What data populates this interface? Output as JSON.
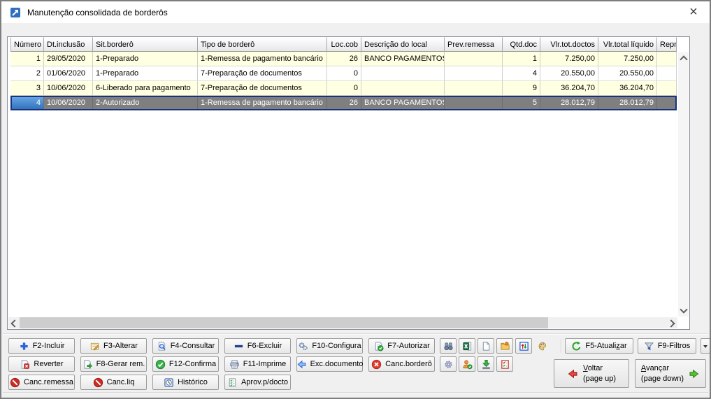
{
  "window": {
    "title": "Manutenção consolidada de borderôs",
    "close_glyph": "×"
  },
  "table": {
    "columns": [
      {
        "key": "numero",
        "label": "Número",
        "width": 48,
        "align": "right"
      },
      {
        "key": "dt-inclusao",
        "label": "Dt.inclusão",
        "width": 70,
        "align": "left"
      },
      {
        "key": "sit-bordero",
        "label": "Sit.borderô",
        "width": 150,
        "align": "left"
      },
      {
        "key": "tipo-bordero",
        "label": "Tipo de borderô",
        "width": 185,
        "align": "left"
      },
      {
        "key": "loc-cob",
        "label": "Loc.cob",
        "width": 49,
        "align": "right"
      },
      {
        "key": "descricao-local",
        "label": "Descrição do local",
        "width": 119,
        "align": "left"
      },
      {
        "key": "prev-remessa",
        "label": "Prev.remessa",
        "width": 83,
        "align": "left"
      },
      {
        "key": "qtd-doc",
        "label": "Qtd.doc",
        "width": 54,
        "align": "right"
      },
      {
        "key": "vlr-tot-doctos",
        "label": "Vlr.tot.doctos",
        "width": 83,
        "align": "right"
      },
      {
        "key": "vlr-total-liquido",
        "label": "Vlr.total líquido",
        "width": 84,
        "align": "right"
      },
      {
        "key": "repre",
        "label": "Repre",
        "width": 28,
        "align": "left"
      }
    ],
    "rows": [
      {
        "selected": false,
        "cells": [
          "1",
          "29/05/2020",
          "1-Preparado",
          "1-Remessa de pagamento bancário",
          "26",
          "BANCO PAGAMENTOS",
          "",
          "1",
          "7.250,00",
          "7.250,00",
          ""
        ]
      },
      {
        "selected": false,
        "cells": [
          "2",
          "01/06/2020",
          "1-Preparado",
          "7-Preparação de documentos",
          "0",
          "",
          "",
          "4",
          "20.550,00",
          "20.550,00",
          ""
        ]
      },
      {
        "selected": false,
        "cells": [
          "3",
          "10/06/2020",
          "6-Liberado para pagamento",
          "7-Preparação de documentos",
          "0",
          "",
          "",
          "9",
          "36.204,70",
          "36.204,70",
          ""
        ]
      },
      {
        "selected": true,
        "cells": [
          "4",
          "10/06/2020",
          "2-Autorizado",
          "1-Remessa de pagamento bancário",
          "26",
          "BANCO PAGAMENTOS",
          "",
          "5",
          "28.012,79",
          "28.012,79",
          ""
        ]
      }
    ]
  },
  "toolbar": {
    "rows": [
      [
        {
          "id": "f2-incluir-button",
          "icon": "plus-icon",
          "label": "F2-Incluir"
        },
        {
          "id": "f3-alterar-button",
          "icon": "note-edit-icon",
          "label": "F3-Alterar"
        },
        {
          "id": "f4-consultar-button",
          "icon": "search-doc-icon",
          "label": "F4-Consultar"
        },
        {
          "id": "f6-excluir-button",
          "icon": "minus-icon",
          "label": "F6-Excluir"
        },
        {
          "id": "f10-configura-button",
          "icon": "gears-icon",
          "label": "F10-Configura"
        },
        {
          "id": "f7-autorizar-button",
          "icon": "doc-check-icon",
          "label": "F7-Autorizar"
        }
      ],
      [
        {
          "id": "reverter-button",
          "icon": "doc-cancel-icon",
          "label": "Reverter"
        },
        {
          "id": "f8-gerar-rem-button",
          "icon": "doc-arrow-icon",
          "label": "F8-Gerar rem."
        },
        {
          "id": "f12-confirma-button",
          "icon": "check-circle-icon",
          "label": "F12-Confirma"
        },
        {
          "id": "f11-imprime-button",
          "icon": "printer-icon",
          "label": "F11-Imprime"
        },
        {
          "id": "exc-documento-button",
          "icon": "arrow-left-icon",
          "label": "Exc.documento"
        },
        {
          "id": "canc-bordero-button",
          "icon": "x-circle-icon",
          "label": "Canc.borderô"
        }
      ],
      [
        {
          "id": "canc-remessa-button",
          "icon": "no-entry-icon",
          "label": "Canc.remessa"
        },
        {
          "id": "canc-liq-button",
          "icon": "no-entry-icon",
          "label": "Canc.liq"
        },
        {
          "id": "historico-button",
          "icon": "clock-icon",
          "label": "Histórico"
        },
        {
          "id": "aprov-p-docto-button",
          "icon": "clipboard-check-icon",
          "label": "Aprov.p/docto"
        }
      ]
    ],
    "icon_rows": [
      [
        {
          "id": "binoculars-button",
          "icon": "binoculars-icon"
        },
        {
          "id": "export-excel-button",
          "icon": "excel-icon"
        },
        {
          "id": "new-doc-button",
          "icon": "doc-blank-icon"
        },
        {
          "id": "folder-note-button",
          "icon": "folder-note-icon"
        },
        {
          "id": "sort-button",
          "icon": "sort-updown-icon"
        },
        {
          "id": "palette-button",
          "icon": "palette-icon",
          "flat": true
        }
      ],
      [
        {
          "id": "settings-button",
          "icon": "gear-icon"
        },
        {
          "id": "user-check-button",
          "icon": "person-check-icon"
        },
        {
          "id": "download-button",
          "icon": "download-icon"
        },
        {
          "id": "checklist-button",
          "icon": "checklist-icon"
        }
      ]
    ],
    "right": {
      "f5_pre": "F5-Atuali",
      "f5_u": "z",
      "f5_post": "ar",
      "f9_label": "F9-Filtros"
    }
  },
  "nav": {
    "voltar_line1": "Voltar",
    "voltar_line2": "(page up)",
    "avancar_line1": "Avançar",
    "avancar_line2": "(page down)"
  }
}
